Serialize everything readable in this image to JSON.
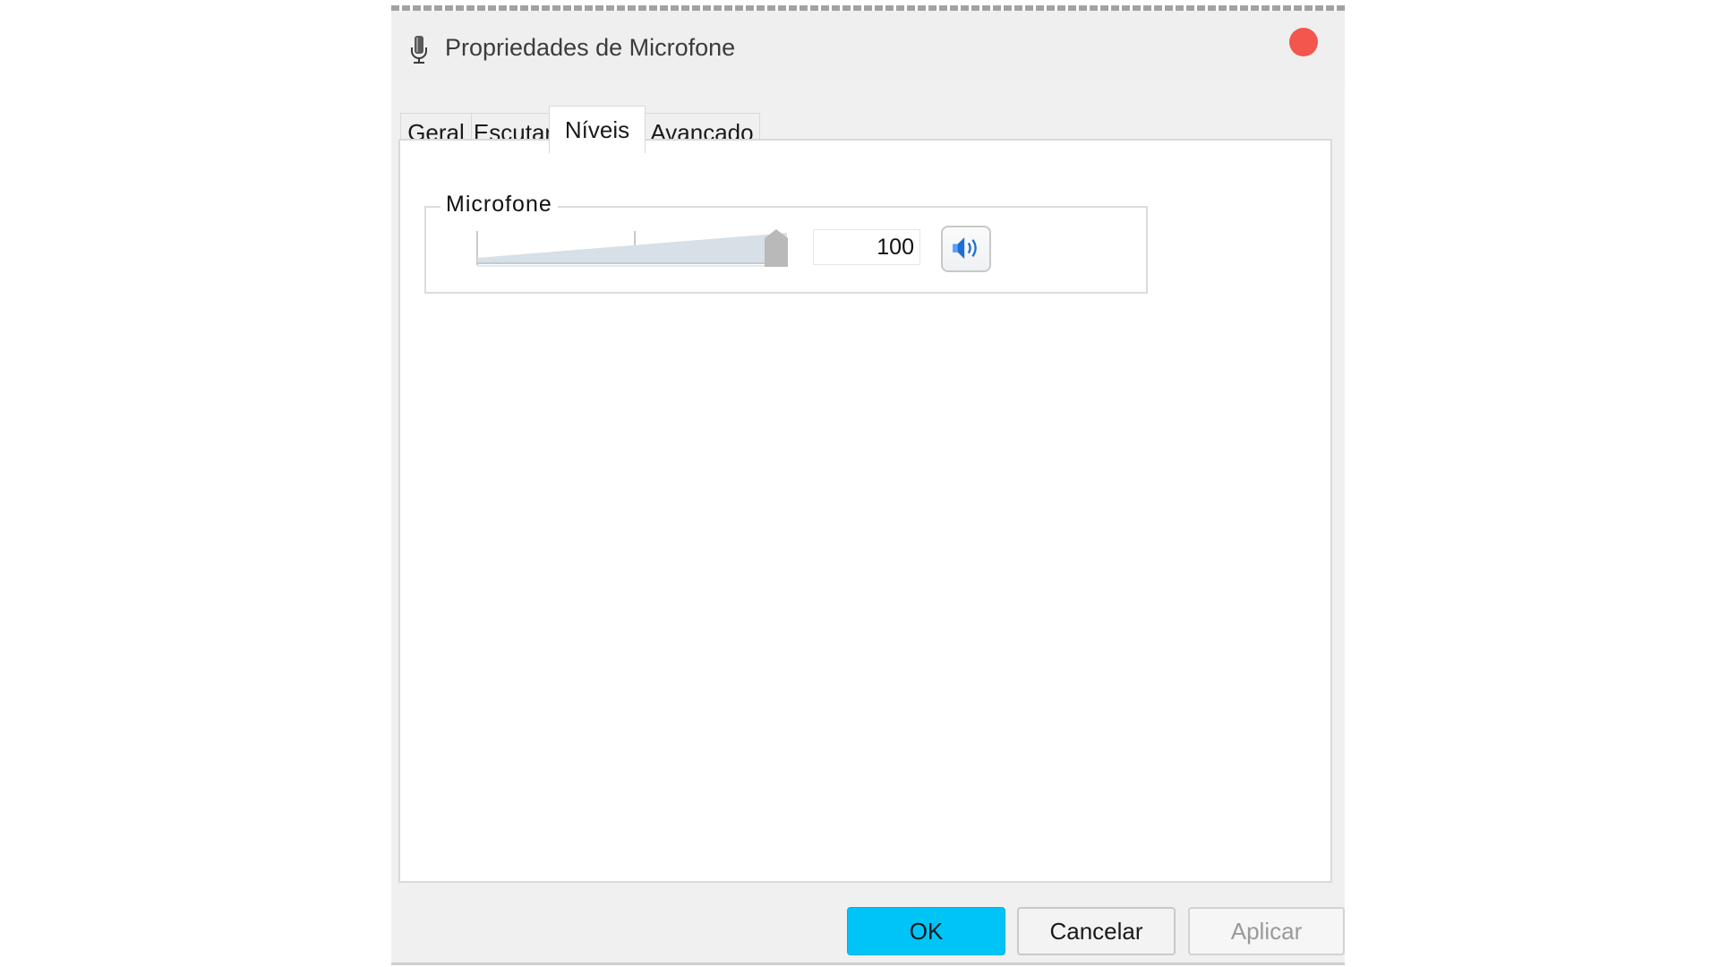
{
  "window": {
    "title": "Propriedades de Microfone",
    "title_icon": "microphone-icon",
    "close_color": "#f2564c"
  },
  "tabs": [
    {
      "label": "Geral",
      "active": false
    },
    {
      "label": "Escutar",
      "active": false
    },
    {
      "label": "Níveis",
      "active": true
    },
    {
      "label": "Avançado",
      "active": false
    }
  ],
  "levels": {
    "group_label": "Microfone",
    "slider": {
      "value": 100,
      "min": 0,
      "max": 100
    },
    "value_text": "100",
    "mute_icon": "speaker-icon"
  },
  "buttons": {
    "ok": "OK",
    "cancel": "Cancelar",
    "apply": "Aplicar"
  },
  "colors": {
    "ok_button": "#00c4f5",
    "speaker_icon": "#1f6fd0"
  }
}
